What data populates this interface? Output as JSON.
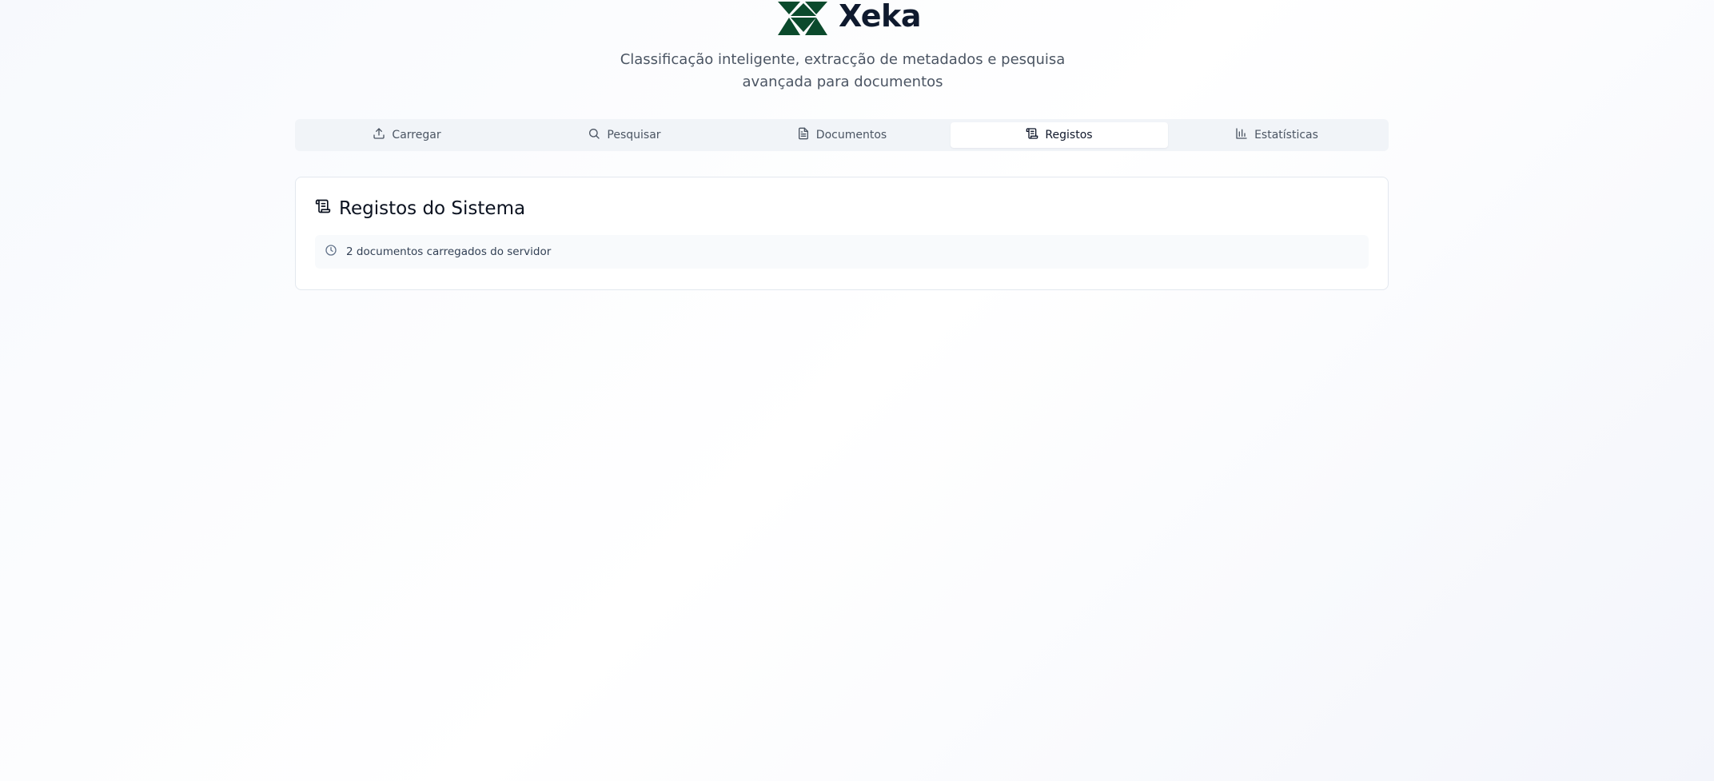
{
  "brand": {
    "name": "Xeka",
    "logo_color": "#0b4a2c",
    "logo_icon": "xeka-logo-icon"
  },
  "subtitle": "Classificação inteligente, extracção de metadados e pesquisa avançada para documentos",
  "tabs": [
    {
      "label": "Carregar",
      "icon": "upload-icon",
      "active": false
    },
    {
      "label": "Pesquisar",
      "icon": "search-icon",
      "active": false
    },
    {
      "label": "Documentos",
      "icon": "document-icon",
      "active": false
    },
    {
      "label": "Registos",
      "icon": "scroll-icon",
      "active": true
    },
    {
      "label": "Estatísticas",
      "icon": "bar-chart-icon",
      "active": false
    }
  ],
  "logs_card": {
    "title": "Registos do Sistema",
    "title_icon": "scroll-icon",
    "entries": [
      {
        "icon": "clock-icon",
        "text": "2 documentos carregados do servidor"
      }
    ]
  },
  "colors": {
    "tab_bar_bg": "#f1f4f8",
    "active_tab_bg": "#ffffff",
    "card_border": "#e3e8ef",
    "log_row_bg": "#f8fafc"
  }
}
